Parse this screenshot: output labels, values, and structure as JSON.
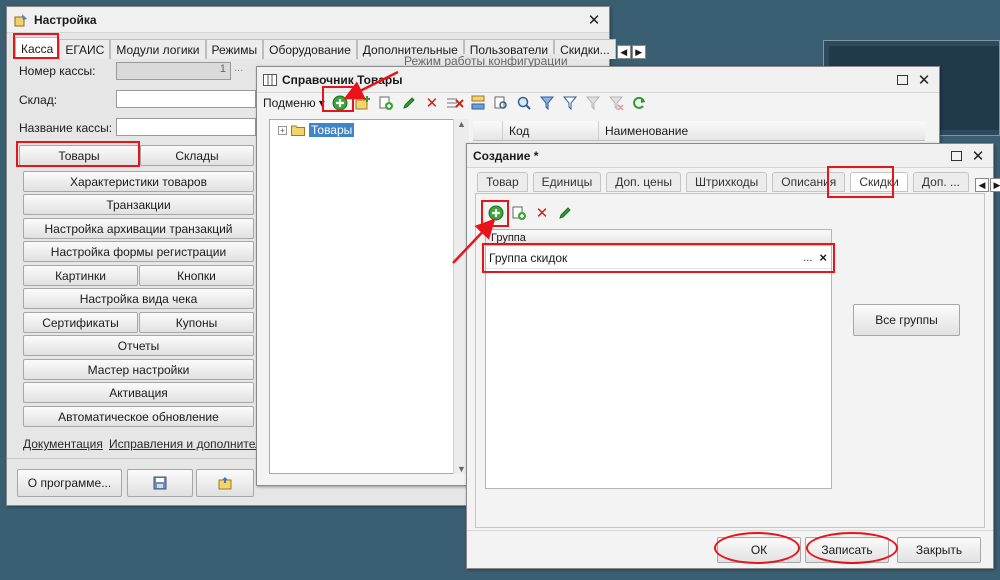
{
  "settings": {
    "title": "Настройка",
    "tabs": [
      "Касса",
      "ЕГАИС",
      "Модули логики",
      "Режимы",
      "Оборудование",
      "Дополнительные",
      "Пользователи",
      "Скидки..."
    ],
    "register_number_label": "Номер кассы:",
    "register_number_value": "1",
    "ellipsis": "...",
    "warehouse_label": "Склад:",
    "register_name_label": "Название кассы:",
    "group_title": "Режим работы конфигурации",
    "buttons": {
      "goods": "Товары",
      "warehouses": "Склады",
      "characteristics": "Характеристики товаров",
      "transactions": "Транзакции",
      "archive_settings": "Настройка архивации транзакций",
      "registration_form": "Настройка формы регистрации",
      "pictures": "Картинки",
      "buttons": "Кнопки",
      "receipt_view": "Настройка вида чека",
      "certificates": "Сертификаты",
      "coupons": "Купоны",
      "reports": "Отчеты",
      "setup_wizard": "Мастер настройки",
      "activation": "Активация",
      "auto_update": "Автоматическое обновление"
    },
    "links": [
      "Документация",
      "Исправления и дополнительн"
    ],
    "about_button": "О программе..."
  },
  "catalog": {
    "title": "Справочник Товары",
    "submenu_label": "Подменю",
    "tree_root": "Товары",
    "columns": [
      "Код",
      "Наименование"
    ]
  },
  "create": {
    "title": "Создание *",
    "tabs": [
      "Товар",
      "Единицы",
      "Доп. цены",
      "Штрихкоды",
      "Описания",
      "Скидки",
      "Доп. ..."
    ],
    "group_column": "Группа",
    "group_value": "Группа скидок",
    "ellipsis": "...",
    "clear": "×",
    "all_groups_button": "Все группы",
    "ok_button": "ОК",
    "save_button": "Записать",
    "close_button": "Закрыть"
  },
  "colors": {
    "highlight": "#e8141a",
    "desktop": "#3b5f72",
    "selection": "#3f86c9"
  },
  "icons": [
    "settings-icon",
    "close-icon",
    "maximize-icon",
    "add-icon",
    "copy-icon",
    "delete-icon",
    "edit-icon",
    "save-disk-icon",
    "folder-icon",
    "refresh-icon",
    "filter-icon",
    "grid-icon"
  ]
}
